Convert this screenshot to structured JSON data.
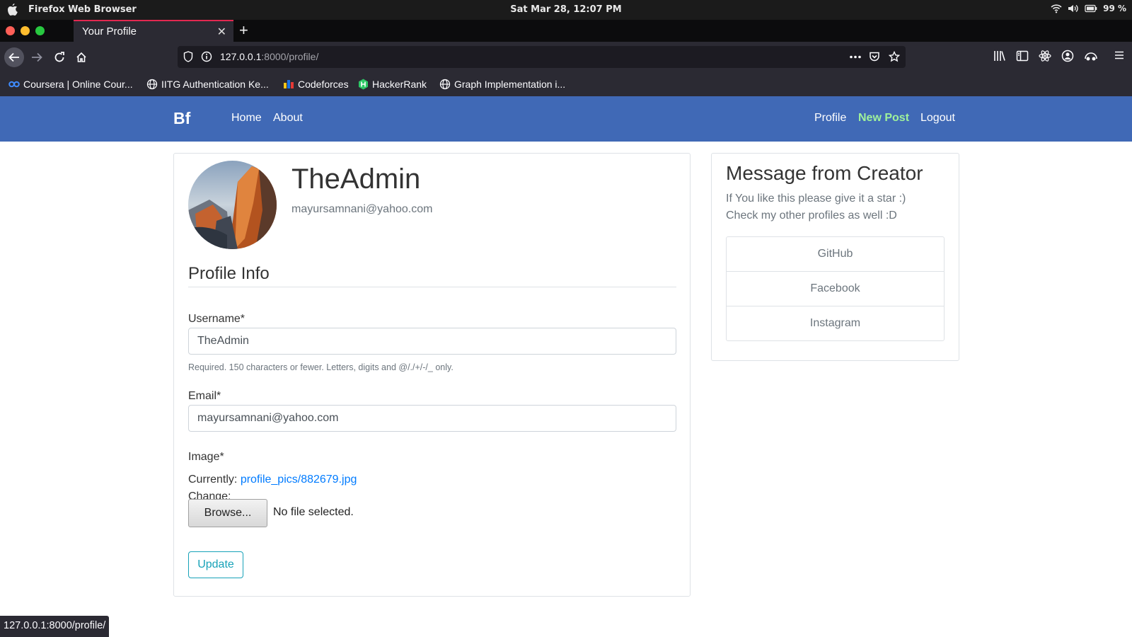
{
  "os": {
    "app_name": "Firefox Web Browser",
    "clock": "Sat Mar 28, 12:07 PM",
    "battery": "99 %"
  },
  "browser": {
    "tab_title": "Your Profile",
    "url_host": "127.0.0.1",
    "url_rest": ":8000/profile/",
    "status_url": "127.0.0.1:8000/profile/",
    "bookmarks": [
      {
        "label": "Coursera | Online Cour...",
        "icon": "coursera-icon"
      },
      {
        "label": "IITG Authentication Ke...",
        "icon": "globe-icon"
      },
      {
        "label": "Codeforces",
        "icon": "codeforces-icon"
      },
      {
        "label": "HackerRank",
        "icon": "hackerrank-icon"
      },
      {
        "label": "Graph Implementation i...",
        "icon": "globe-icon"
      }
    ]
  },
  "site_nav": {
    "brand": "Bf",
    "home": "Home",
    "about": "About",
    "profile": "Profile",
    "new_post": "New Post",
    "logout": "Logout",
    "bg_color": "#4069b6",
    "new_post_color": "#9ff29b"
  },
  "profile": {
    "username": "TheAdmin",
    "email": "mayursamnani@yahoo.com",
    "section_title": "Profile Info",
    "username_label": "Username*",
    "username_value": "TheAdmin",
    "username_help": "Required. 150 characters or fewer. Letters, digits and @/./+/-/_ only.",
    "email_label": "Email*",
    "email_value": "mayursamnani@yahoo.com",
    "image_label": "Image*",
    "currently_label": "Currently:",
    "current_image": "profile_pics/882679.jpg",
    "change_label": "Change:",
    "browse_label": "Browse...",
    "no_file": "No file selected.",
    "update_label": "Update"
  },
  "sidebar": {
    "title": "Message from Creator",
    "line1": "If You like this please give it a star :)",
    "line2": "Check my other profiles as well :D",
    "links": [
      "GitHub",
      "Facebook",
      "Instagram"
    ]
  }
}
